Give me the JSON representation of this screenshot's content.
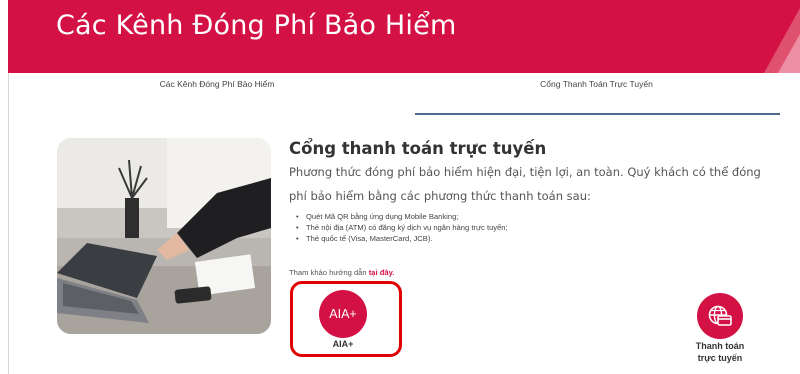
{
  "banner": {
    "title": "Các Kênh Đóng Phí Bảo Hiểm",
    "accent_color": "#d31145"
  },
  "tabs": [
    {
      "label": "Các Kênh Đóng Phí Bảo Hiểm",
      "active": false
    },
    {
      "label": "Cổng Thanh Toán Trực Tuyến",
      "active": true
    }
  ],
  "section": {
    "title": "Cổng thanh toán trực tuyến",
    "description": "Phương thức đóng phí bảo hiểm hiện đại, tiện lợi, an toàn.  Quý khách có thể đóng phí bảo hiểm bằng các phương thức thanh toán sau:",
    "bullets": [
      "Quét Mã QR bằng ứng dụng Mobile Banking;",
      "Thẻ nội địa (ATM) có đăng ký dịch vụ ngân hàng trực tuyến;",
      "Thẻ quốc tế (Visa, MasterCard, JCB)."
    ],
    "guide_prefix": "Tham khảo hướng dẫn ",
    "guide_link": "tại đây."
  },
  "options": {
    "aia": {
      "icon_text": "AIA+",
      "label": "AIA+",
      "icon": "aia-plus-logo"
    },
    "online": {
      "label_line1": "Thanh toán",
      "label_line2": "trực tuyến",
      "icon": "globe-card-icon"
    }
  },
  "highlight_color": "#e00000"
}
